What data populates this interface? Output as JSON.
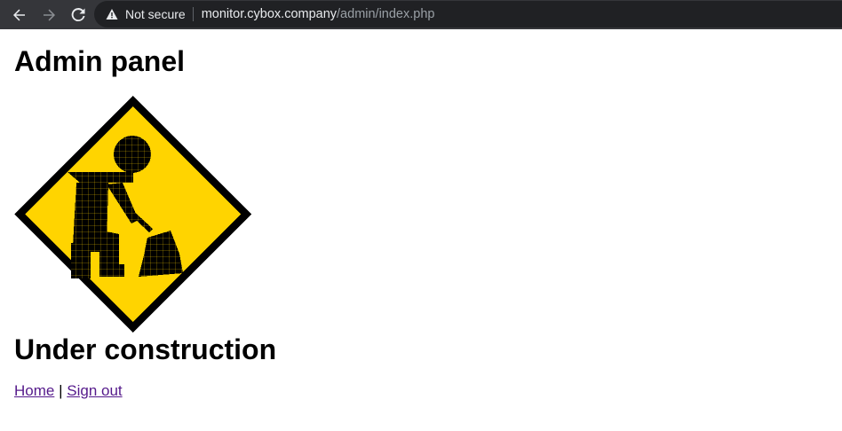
{
  "browser": {
    "security_label": "Not secure",
    "url_host": "monitor.cybox.company",
    "url_path": "/admin/index.php"
  },
  "page": {
    "title": "Admin panel",
    "image": {
      "icon": "under-construction-worker-sign",
      "colors": {
        "fill": "#ffd400",
        "outline": "#000000"
      }
    },
    "subtitle": "Under construction",
    "links": {
      "home": "Home",
      "separator": "|",
      "sign_out": "Sign out"
    }
  }
}
